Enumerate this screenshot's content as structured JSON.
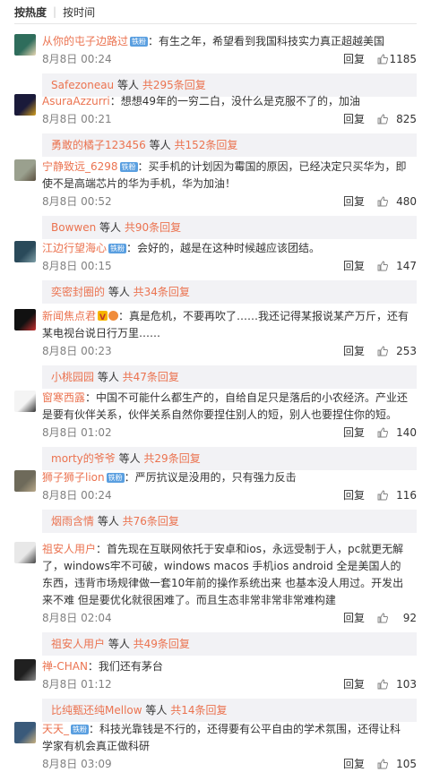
{
  "sort": {
    "hot": "按热度",
    "time": "按时间"
  },
  "comments": [
    {
      "user": "从你的屯子边路过",
      "badge": "铁粉",
      "text": "：有生之年，希望看到我国科技实力真正超越美国",
      "time": "8月8日 00:24",
      "reply": "回复",
      "likes": "1185",
      "sub": {
        "user": "Safezoneau",
        "mid": " 等人 ",
        "count": "共295条回复"
      },
      "avatar_colors": [
        "#2f6d5c",
        "#e9d8b5"
      ]
    },
    {
      "user": "AsuraAzzurri",
      "badge": "",
      "text": "：想想49年的一穷二白，没什么是克服不了的，加油",
      "time": "8月8日 00:21",
      "reply": "回复",
      "likes": "825",
      "sub": {
        "user": "勇敢的橘子123456",
        "mid": " 等人 ",
        "count": "共152条回复"
      },
      "avatar_colors": [
        "#1a1a3a",
        "#d4a020"
      ]
    },
    {
      "user": "宁静致远_6298",
      "badge": "铁粉",
      "text": "：买手机的计划因为霉国的原因，已经决定只买华为，即使不是高端芯片的华为手机，华为加油！",
      "time": "8月8日 00:52",
      "reply": "回复",
      "likes": "480",
      "sub": {
        "user": "Bowwen",
        "mid": " 等人 ",
        "count": "共90条回复"
      },
      "avatar_colors": [
        "#9aa08e",
        "#5a4f3e"
      ]
    },
    {
      "user": "江边行望海心",
      "badge": "铁粉",
      "text": "：会好的，越是在这种时候越应该团结。",
      "time": "8月8日 00:15",
      "reply": "回复",
      "likes": "147",
      "sub": {
        "user": "奕密封圈的",
        "mid": " 等人 ",
        "count": "共34条回复"
      },
      "avatar_colors": [
        "#2a4a5a",
        "#7fa0a8"
      ]
    },
    {
      "user": "新闻焦点君",
      "badge": "",
      "vip": true,
      "text": "：真是危机，不要再吹了……我还记得某报说某产万斤，还有某电视台说日行万里……",
      "time": "8月8日 00:23",
      "reply": "回复",
      "likes": "253",
      "sub": {
        "user": "小桃园园",
        "mid": " 等人 ",
        "count": "共47条回复"
      },
      "avatar_colors": [
        "#111111",
        "#c93030"
      ]
    },
    {
      "user": "窗寒西露",
      "badge": "",
      "text": "：中国不可能什么都生产的，自给自足只是落后的小农经济。产业还是要有伙伴关系，伙伴关系自然你要捏住别人的短，别人也要捏住你的短。",
      "time": "8月8日 01:02",
      "reply": "回复",
      "likes": "140",
      "sub": {
        "user": "morty的爷爷",
        "mid": " 等人 ",
        "count": "共29条回复"
      },
      "avatar_colors": [
        "#f4f4f4",
        "#333333"
      ]
    },
    {
      "user": "狮子狮子lion",
      "badge": "铁粉",
      "text": "：严厉抗议是没用的，只有强力反击",
      "time": "8月8日 00:24",
      "reply": "回复",
      "likes": "116",
      "sub": {
        "user": "烟雨含情",
        "mid": " 等人 ",
        "count": "共76条回复"
      },
      "avatar_colors": [
        "#6e6a5a",
        "#b9a98a"
      ]
    },
    {
      "user": "祖安人用户",
      "badge": "",
      "text": "：首先现在互联网依托于安卓和ios，永远受制于人，pc就更无解了，windows牢不可破，windows macos 手机ios android 全是美国人的东西，违背市场规律做一套10年前的操作系统出来 也基本没人用过。开发出来不难 但是要优化就很困难了。而且生态非常非常非常难构建",
      "time": "8月8日 02:04",
      "reply": "回复",
      "likes": "92",
      "sub": {
        "user": "祖安人用户",
        "mid": " 等人 ",
        "count": "共49条回复"
      },
      "avatar_colors": [
        "#e8e8e8",
        "#444444"
      ]
    },
    {
      "user": "禅-CHAN",
      "badge": "",
      "text": "：我们还有茅台",
      "time": "8月8日 01:12",
      "reply": "回复",
      "likes": "103",
      "sub": {
        "user": "比纯甄还纯Mellow",
        "mid": " 等人 ",
        "count": "共14条回复"
      },
      "avatar_colors": [
        "#202020",
        "#8a8a8a"
      ]
    },
    {
      "user": "天天_",
      "badge": "铁粉",
      "text": "：科技光靠钱是不行的，还得要有公平自由的学术氛围，还得让科学家有机会真正做科研",
      "time": "8月8日 03:09",
      "reply": "回复",
      "likes": "105",
      "sub": {
        "user": "",
        "mid": "",
        "count": ""
      },
      "avatar_colors": [
        "#3a5a7a",
        "#c8b080"
      ]
    }
  ]
}
